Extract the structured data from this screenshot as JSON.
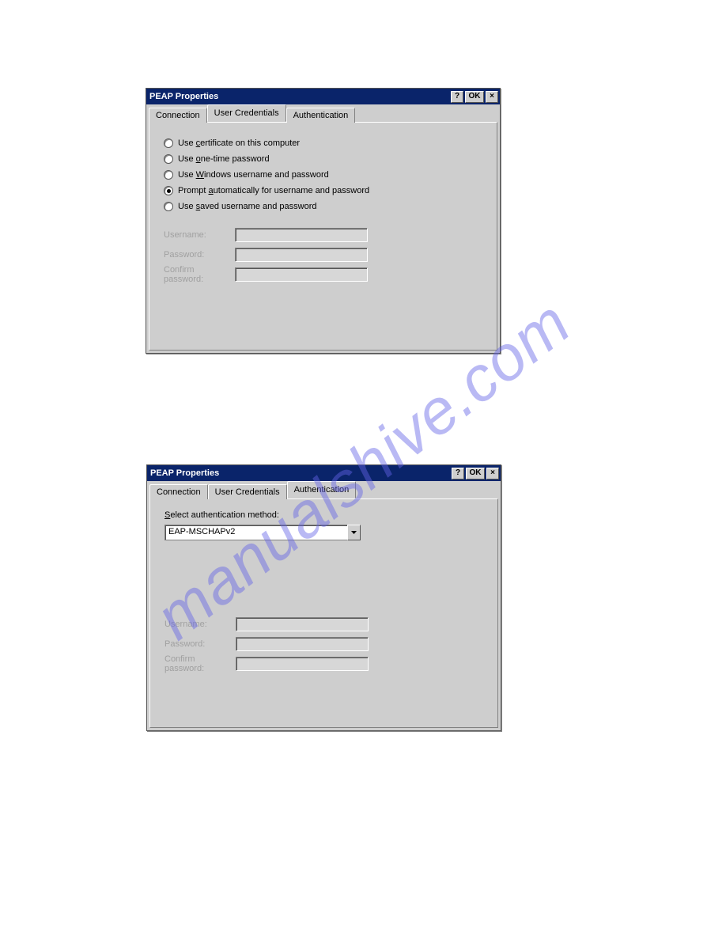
{
  "watermark": "manualshive.com",
  "dialog1": {
    "title": "PEAP Properties",
    "btn_help": "?",
    "btn_ok": "OK",
    "btn_close": "×",
    "tabs": [
      "Connection",
      "User Credentials",
      "Authentication"
    ],
    "active_tab": 1,
    "radios": [
      {
        "pre": "Use ",
        "u": "c",
        "post": "ertificate on this computer",
        "selected": false
      },
      {
        "pre": "Use ",
        "u": "o",
        "post": "ne-time password",
        "selected": false
      },
      {
        "pre": "Use ",
        "u": "W",
        "post": "indows username and password",
        "selected": false
      },
      {
        "pre": "Prompt ",
        "u": "a",
        "post": "utomatically for username and password",
        "selected": true
      },
      {
        "pre": "Use ",
        "u": "s",
        "post": "aved username and password",
        "selected": false
      }
    ],
    "fields": {
      "username": "Username:",
      "password": "Password:",
      "confirm": "Confirm password:"
    }
  },
  "dialog2": {
    "title": "PEAP Properties",
    "btn_help": "?",
    "btn_ok": "OK",
    "btn_close": "×",
    "tabs": [
      "Connection",
      "User Credentials",
      "Authentication"
    ],
    "active_tab": 2,
    "select_label_pre": "",
    "select_label_u": "S",
    "select_label_post": "elect authentication method:",
    "select_value": "EAP-MSCHAPv2",
    "fields": {
      "username": "Username:",
      "password": "Password:",
      "confirm": "Confirm password:"
    }
  }
}
